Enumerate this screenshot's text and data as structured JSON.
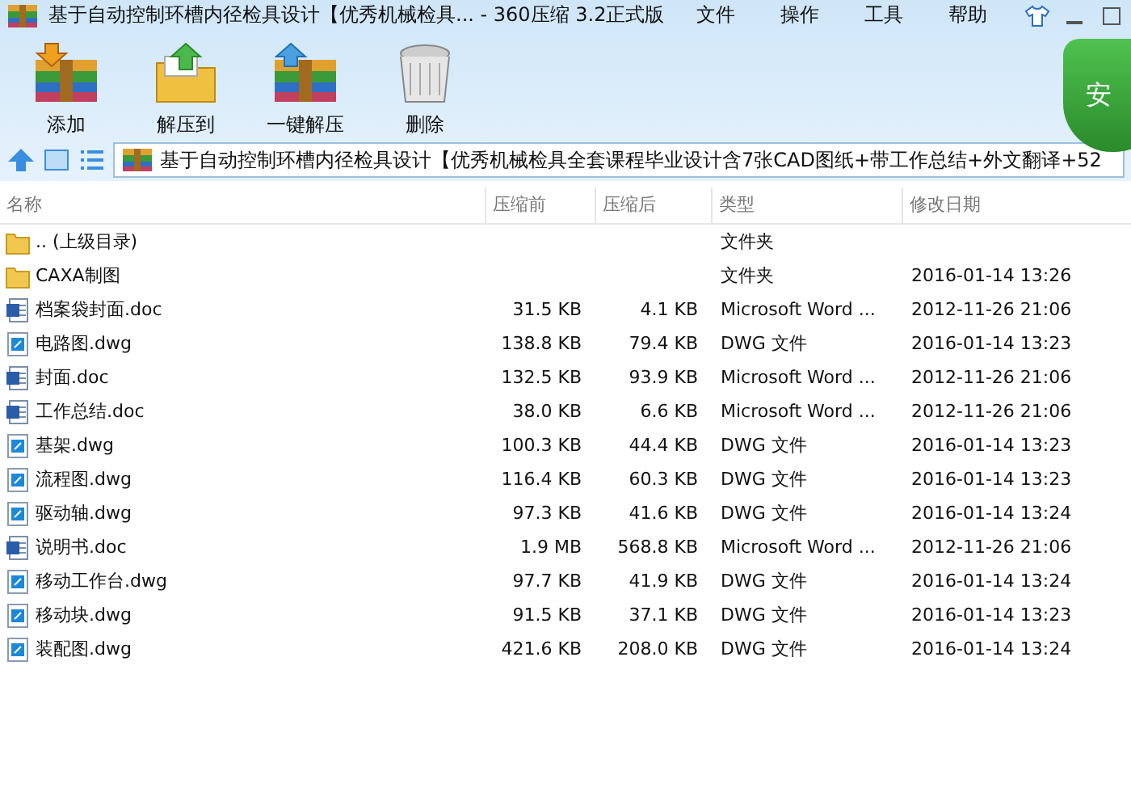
{
  "window": {
    "title": "基于自动控制环槽内径检具设计【优秀机械检具... - 360压缩 3.2正式版"
  },
  "menu": [
    "文件",
    "操作",
    "工具",
    "帮助"
  ],
  "toolbar": [
    {
      "label": "添加",
      "kind": "add"
    },
    {
      "label": "解压到",
      "kind": "extract"
    },
    {
      "label": "一键解压",
      "kind": "oneclick"
    },
    {
      "label": "删除",
      "kind": "delete"
    }
  ],
  "security_badge": "安",
  "address": "基于自动控制环槽内径检具设计【优秀机械检具全套课程毕业设计含7张CAD图纸+带工作总结+外文翻译+52",
  "table": {
    "columns": [
      "名称",
      "压缩前",
      "压缩后",
      "类型",
      "修改日期"
    ],
    "rows": [
      {
        "kind": "folder",
        "name": ".. (上级目录)",
        "size": "",
        "packed": "",
        "type": "文件夹",
        "date": ""
      },
      {
        "kind": "folder",
        "name": "CAXA制图",
        "size": "",
        "packed": "",
        "type": "文件夹",
        "date": "2016-01-14 13:26"
      },
      {
        "kind": "doc",
        "name": "档案袋封面.doc",
        "size": "31.5 KB",
        "packed": "4.1 KB",
        "type": "Microsoft Word ...",
        "date": "2012-11-26 21:06"
      },
      {
        "kind": "dwg",
        "name": "电路图.dwg",
        "size": "138.8 KB",
        "packed": "79.4 KB",
        "type": "DWG 文件",
        "date": "2016-01-14 13:23"
      },
      {
        "kind": "doc",
        "name": "封面.doc",
        "size": "132.5 KB",
        "packed": "93.9 KB",
        "type": "Microsoft Word ...",
        "date": "2012-11-26 21:06"
      },
      {
        "kind": "doc",
        "name": "工作总结.doc",
        "size": "38.0 KB",
        "packed": "6.6 KB",
        "type": "Microsoft Word ...",
        "date": "2012-11-26 21:06"
      },
      {
        "kind": "dwg",
        "name": "基架.dwg",
        "size": "100.3 KB",
        "packed": "44.4 KB",
        "type": "DWG 文件",
        "date": "2016-01-14 13:23"
      },
      {
        "kind": "dwg",
        "name": "流程图.dwg",
        "size": "116.4 KB",
        "packed": "60.3 KB",
        "type": "DWG 文件",
        "date": "2016-01-14 13:23"
      },
      {
        "kind": "dwg",
        "name": "驱动轴.dwg",
        "size": "97.3 KB",
        "packed": "41.6 KB",
        "type": "DWG 文件",
        "date": "2016-01-14 13:24"
      },
      {
        "kind": "doc",
        "name": "说明书.doc",
        "size": "1.9 MB",
        "packed": "568.8 KB",
        "type": "Microsoft Word ...",
        "date": "2012-11-26 21:06"
      },
      {
        "kind": "dwg",
        "name": "移动工作台.dwg",
        "size": "97.7 KB",
        "packed": "41.9 KB",
        "type": "DWG 文件",
        "date": "2016-01-14 13:24"
      },
      {
        "kind": "dwg",
        "name": "移动块.dwg",
        "size": "91.5 KB",
        "packed": "37.1 KB",
        "type": "DWG 文件",
        "date": "2016-01-14 13:23"
      },
      {
        "kind": "dwg",
        "name": "装配图.dwg",
        "size": "421.6 KB",
        "packed": "208.0 KB",
        "type": "DWG 文件",
        "date": "2016-01-14 13:24"
      }
    ]
  }
}
